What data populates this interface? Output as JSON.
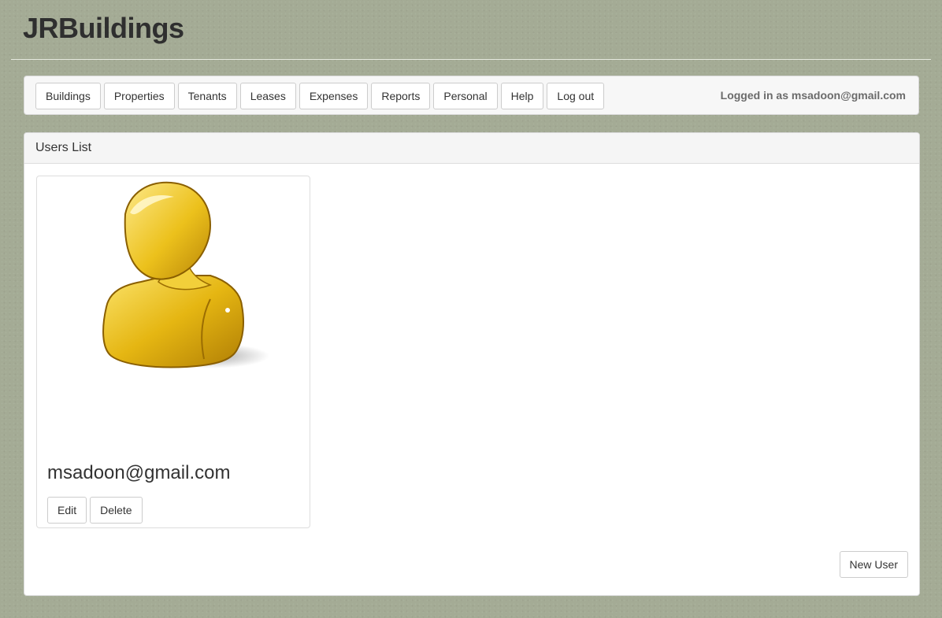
{
  "app": {
    "title": "JRBuildings"
  },
  "nav": {
    "items": [
      {
        "label": "Buildings"
      },
      {
        "label": "Properties"
      },
      {
        "label": "Tenants"
      },
      {
        "label": "Leases"
      },
      {
        "label": "Expenses"
      },
      {
        "label": "Reports"
      },
      {
        "label": "Personal"
      },
      {
        "label": "Help"
      },
      {
        "label": "Log out"
      }
    ],
    "logged_in_text": "Logged in as msadoon@gmail.com"
  },
  "panel": {
    "heading": "Users List",
    "users": [
      {
        "email": "msadoon@gmail.com",
        "avatar_icon": "user-avatar-icon",
        "edit_label": "Edit",
        "delete_label": "Delete"
      }
    ],
    "new_user_label": "New User"
  },
  "colors": {
    "page_background": "#a4ab95",
    "avatar_gold": "#e5b612"
  }
}
